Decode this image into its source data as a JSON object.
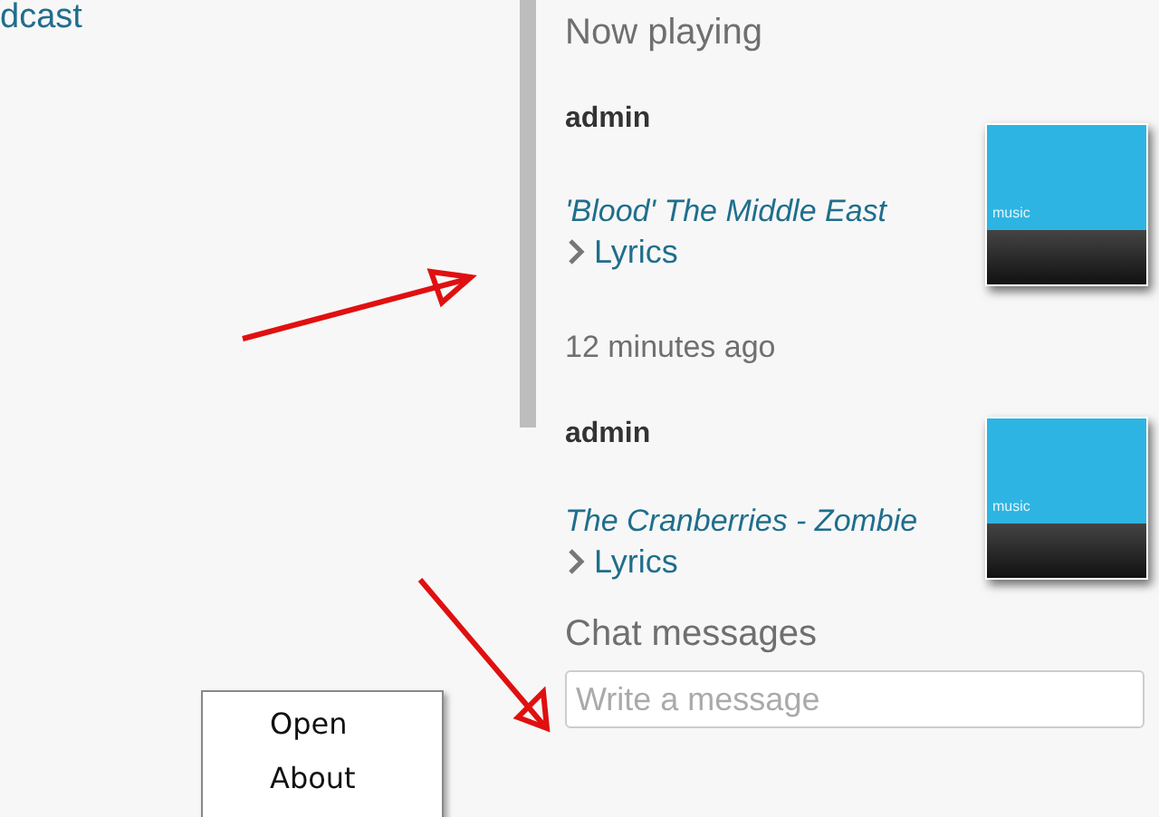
{
  "sidebar": {
    "link": "dcast"
  },
  "now_playing": {
    "title": "Now playing",
    "entries": [
      {
        "user": "admin",
        "track": "'Blood' The Middle East",
        "lyrics": "Lyrics",
        "art_label": "music",
        "time": "12 minutes ago"
      },
      {
        "user": "admin",
        "track": "The Cranberries - Zombie",
        "lyrics": "Lyrics",
        "art_label": "music"
      }
    ]
  },
  "chat": {
    "title": "Chat messages",
    "placeholder": "Write a message"
  },
  "context_menu": {
    "items": [
      "Open",
      "About"
    ]
  }
}
